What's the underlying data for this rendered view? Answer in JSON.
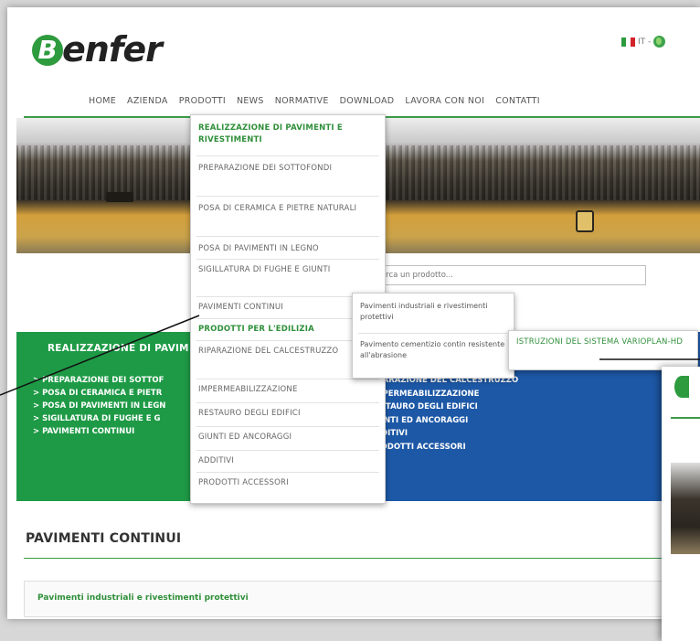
{
  "brand": {
    "logo_letter": "B",
    "logo_rest": "enfer"
  },
  "language": {
    "code": "IT",
    "separator": "-",
    "flag_colors": [
      "#2e9b3e",
      "#ffffff",
      "#d2232a"
    ]
  },
  "nav": {
    "items": [
      "HOME",
      "AZIENDA",
      "PRODOTTI",
      "NEWS",
      "NORMATIVE",
      "DOWNLOAD",
      "LAVORA CON NOI",
      "CONTATTI"
    ]
  },
  "search": {
    "placeholder": "Cerca un prodotto..."
  },
  "green_panel": {
    "title": "REALIZZAZIONE DI PAVIM",
    "items": [
      "> PREPARAZIONE DEI SOTTOF",
      "> POSA DI CERAMICA E PIETR",
      "> POSA DI PAVIMENTI IN LEGN",
      "> SIGILLATURA DI FUGHE E G",
      "> PAVIMENTI CONTINUI"
    ]
  },
  "blue_panel": {
    "items": [
      "IPARAZIONE DEL CALCESTRUZZO",
      "MPERMEABILIZZAZIONE",
      "ESTAURO DEGLI EDIFICI",
      "IUNTI ED ANCORAGGI",
      "DDITIVI",
      "RODOTTI ACCESSORI"
    ]
  },
  "dropdown": {
    "group1_header": "REALIZZAZIONE DI PAVIMENTI E RIVESTIMENTI",
    "group1_items": [
      "PREPARAZIONE DEI SOTTOFONDI",
      "POSA DI CERAMICA E PIETRE NATURALI",
      "POSA DI PAVIMENTI IN LEGNO",
      "SIGILLATURA DI FUGHE E GIUNTI",
      "PAVIMENTI CONTINUI"
    ],
    "group2_header": "PRODOTTI PER L'EDILIZIA",
    "group2_items": [
      "RIPARAZIONE DEL CALCESTRUZZO",
      "IMPERMEABILIZZAZIONE",
      "RESTAURO DEGLI EDIFICI",
      "GIUNTI ED ANCORAGGI",
      "ADDITIVI",
      "PRODOTTI ACCESSORI"
    ]
  },
  "submenu": {
    "items": [
      "Pavimenti industriali e rivestimenti protettivi",
      "Pavimento cementizio contin resistente all'abrasione"
    ]
  },
  "submenu2": {
    "item": "ISTRUZIONI DEL SISTEMA VARIOPLAN-HD"
  },
  "section": {
    "title": "PAVIMENTI CONTINUI",
    "accordion_item": "Pavimenti industriali e rivestimenti protettivi"
  },
  "colors": {
    "green": "#1e9a46",
    "blue": "#1d58a6",
    "accent_text": "#2f8f3a"
  }
}
